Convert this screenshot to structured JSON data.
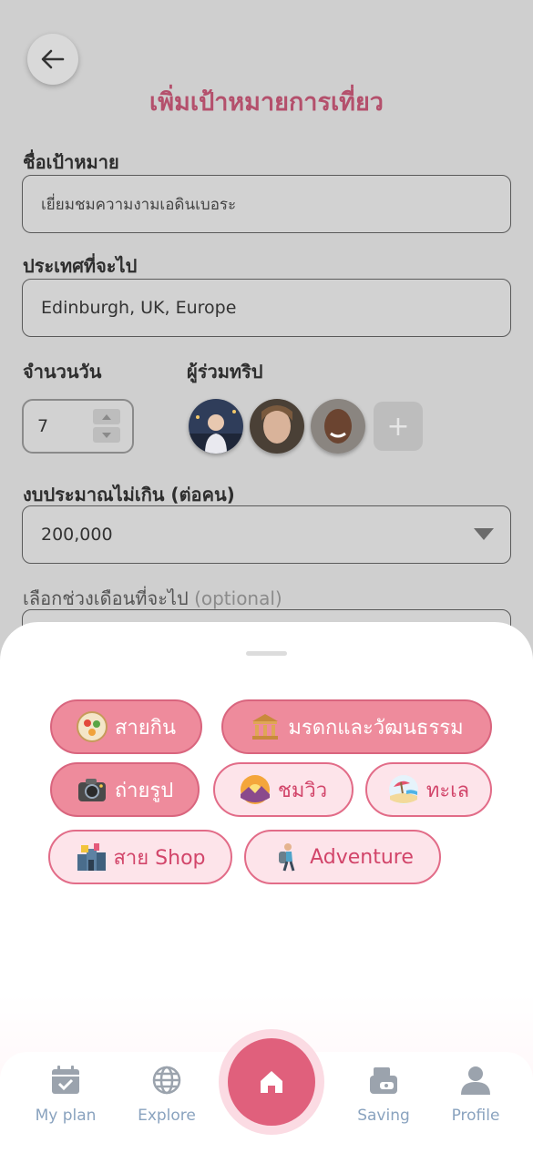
{
  "header": {
    "title": "เพิ่มเป้าหมายการเที่ยว"
  },
  "form": {
    "goal_name": {
      "label": "ชื่อเป้าหมาย",
      "value": "เยี่ยมชมความงามเอดินเบอระ"
    },
    "destination": {
      "label": "ประเทศที่จะไป",
      "value": "Edinburgh, UK, Europe"
    },
    "days": {
      "label": "จำนวนวัน",
      "value": "7"
    },
    "companions": {
      "label": "ผู้ร่วมทริป",
      "add_label": "+"
    },
    "budget": {
      "label": "งบประมาณไม่เกิน (ต่อคน)",
      "value": "200,000"
    },
    "month_range": {
      "label": "เลือกช่วงเดือนที่จะไป",
      "optional": "(optional)"
    }
  },
  "categories": [
    {
      "label": "สายกิน",
      "icon": "food-plate-icon",
      "selected": true
    },
    {
      "label": "มรดกและวัฒนธรรม",
      "icon": "museum-icon",
      "selected": true
    },
    {
      "label": "ถ่ายรูป",
      "icon": "camera-icon",
      "selected": true
    },
    {
      "label": "ชมวิว",
      "icon": "sunset-icon",
      "selected": false
    },
    {
      "label": "ทะเล",
      "icon": "beach-icon",
      "selected": false
    },
    {
      "label": "สาย Shop",
      "icon": "shops-icon",
      "selected": false
    },
    {
      "label": "Adventure",
      "icon": "backpacker-icon",
      "selected": false
    }
  ],
  "nav": {
    "items": [
      {
        "label": "My plan",
        "icon": "calendar-check-icon"
      },
      {
        "label": "Explore",
        "icon": "globe-icon"
      },
      {
        "label": "Saving",
        "icon": "piggy-bank-icon"
      },
      {
        "label": "Profile",
        "icon": "user-icon"
      }
    ],
    "home_icon": "home-icon"
  },
  "colors": {
    "accent": "#e0607c",
    "title": "#b4506c",
    "chip_selected": "#ee8b9c",
    "chip_unselected": "#fde4ea",
    "nav_text": "#8aa3bf"
  }
}
